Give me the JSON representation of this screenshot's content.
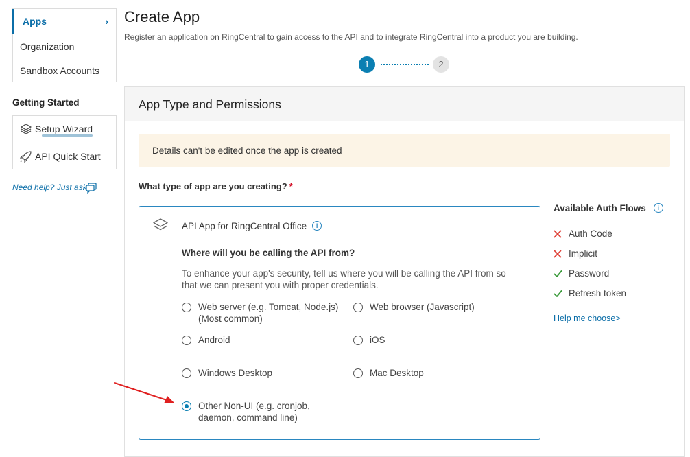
{
  "sidebar": {
    "nav": [
      {
        "label": "Apps",
        "active": true
      },
      {
        "label": "Organization"
      },
      {
        "label": "Sandbox Accounts"
      }
    ],
    "getting_started_title": "Getting Started",
    "getting_started": [
      {
        "label": "Setup Wizard",
        "icon": "layers-icon"
      },
      {
        "label": "API Quick Start",
        "icon": "rocket-icon"
      }
    ],
    "help_link": "Need help? Just ask"
  },
  "header": {
    "title": "Create App",
    "subtitle": "Register an application on RingCentral to gain access to the API and to integrate RingCentral into a product you are building."
  },
  "stepper": {
    "steps": [
      "1",
      "2"
    ],
    "current": 1
  },
  "panel": {
    "title": "App Type and Permissions",
    "notice": "Details can't be edited once the app is created",
    "question": "What type of app are you creating?",
    "required_mark": "*"
  },
  "app_card": {
    "title": "API App for RingCentral Office",
    "info": "i",
    "where_title": "Where will you be calling the API from?",
    "description": "To enhance your app's security, tell us where you will be calling the API from so that we can present you with proper credentials.",
    "platforms": [
      {
        "label": "Web server (e.g. Tomcat, Node.js)",
        "sublabel": "(Most common)",
        "checked": false
      },
      {
        "label": "Web browser (Javascript)",
        "checked": false
      },
      {
        "label": "Android",
        "checked": false
      },
      {
        "label": "iOS",
        "checked": false
      },
      {
        "label": "Windows Desktop",
        "checked": false
      },
      {
        "label": "Mac Desktop",
        "checked": false
      },
      {
        "label": "Other Non-UI (e.g. cronjob,",
        "sublabel": "daemon, command line)",
        "checked": true
      }
    ]
  },
  "auth_flows": {
    "title": "Available Auth Flows",
    "info": "i",
    "items": [
      {
        "label": "Auth Code",
        "available": false
      },
      {
        "label": "Implicit",
        "available": false
      },
      {
        "label": "Password",
        "available": true
      },
      {
        "label": "Refresh token",
        "available": true
      }
    ],
    "help_choose": "Help me choose>"
  },
  "colors": {
    "accent": "#0b7fb2",
    "link": "#0b6ea8",
    "notice_bg": "#fcf4e6",
    "unavailable": "#e0443a",
    "available": "#3a9a3a",
    "annotation_arrow": "#e02020"
  }
}
